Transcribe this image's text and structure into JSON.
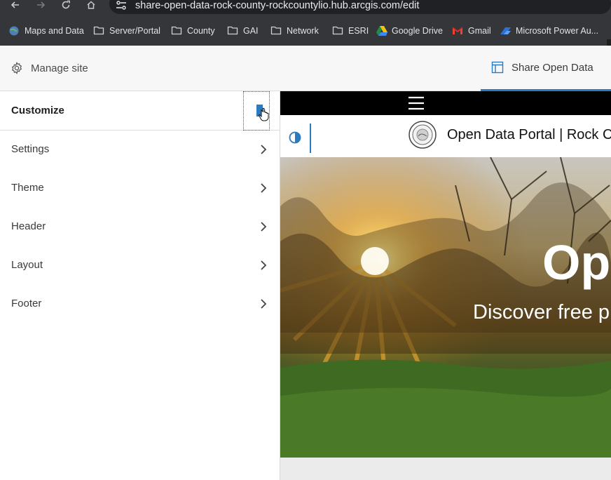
{
  "browser": {
    "url": "share-open-data-rock-county-rockcountylio.hub.arcgis.com/edit",
    "nav_icons": [
      "back-arrow-icon",
      "forward-arrow-icon",
      "reload-icon",
      "home-icon",
      "site-info-icon"
    ],
    "bookmarks": [
      {
        "label": "Maps and Data",
        "icon": "globe-icon"
      },
      {
        "label": "Server/Portal",
        "icon": "folder-icon"
      },
      {
        "label": "County",
        "icon": "folder-icon"
      },
      {
        "label": "GAI",
        "icon": "folder-icon"
      },
      {
        "label": "Network",
        "icon": "folder-icon"
      },
      {
        "label": "ESRI",
        "icon": "folder-icon"
      },
      {
        "label": "Google Drive",
        "icon": "google-drive-icon"
      },
      {
        "label": "Gmail",
        "icon": "gmail-icon"
      },
      {
        "label": "Microsoft Power Au...",
        "icon": "power-automate-icon"
      }
    ]
  },
  "hub_header": {
    "manage_site_label": "Manage site",
    "manage_site_icon": "gear-icon",
    "active_tab_label": "Share Open Data",
    "active_tab_icon": "layout-icon",
    "accent_color": "#2a7bbf"
  },
  "panel": {
    "title": "Customize",
    "collapse_icon": "panel-collapse-icon",
    "items": [
      {
        "label": "Settings"
      },
      {
        "label": "Theme"
      },
      {
        "label": "Header"
      },
      {
        "label": "Layout"
      },
      {
        "label": "Footer"
      }
    ]
  },
  "preview": {
    "menu_icon": "hamburger-icon",
    "contrast_icon": "contrast-icon",
    "portal_title": "Open Data Portal | Rock C",
    "hero_title": "Op",
    "hero_subtitle": "Discover free p"
  }
}
